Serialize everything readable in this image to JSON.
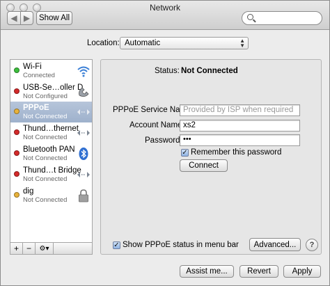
{
  "window": {
    "title": "Network"
  },
  "toolbar": {
    "back": "◀",
    "forward": "▶",
    "show_all": "Show All",
    "search_placeholder": ""
  },
  "location": {
    "label": "Location:",
    "value": "Automatic"
  },
  "services": [
    {
      "name": "Wi-Fi",
      "status": "Connected",
      "dot": "#3cbf3c",
      "icon": "wifi-icon"
    },
    {
      "name": "USB-Se…oller D",
      "status": "Not Configured",
      "dot": "#d42a2a",
      "icon": "phone-icon"
    },
    {
      "name": "PPPoE",
      "status": "Not Connected",
      "dot": "#e8b23a",
      "icon": "ethernet-arrows-icon"
    },
    {
      "name": "Thund…thernet",
      "status": "Not Connected",
      "dot": "#d42a2a",
      "icon": "ethernet-arrows-icon"
    },
    {
      "name": "Bluetooth PAN",
      "status": "Not Connected",
      "dot": "#d42a2a",
      "icon": "bluetooth-icon"
    },
    {
      "name": "Thund…t Bridge",
      "status": "Not Connected",
      "dot": "#d42a2a",
      "icon": "ethernet-arrows-icon"
    },
    {
      "name": "dig",
      "status": "Not Connected",
      "dot": "#e8b23a",
      "icon": "lock-icon"
    }
  ],
  "sidebar_controls": {
    "add": "+",
    "remove": "−",
    "action": "⚙▾"
  },
  "detail": {
    "status_label": "Status:",
    "status_value": "Not Connected",
    "service_name_label": "PPPoE Service Name:",
    "service_name_placeholder": "Provided by ISP when required",
    "account_label": "Account Name:",
    "account_value": "xs2",
    "password_label": "Password:",
    "password_value": "•••",
    "remember_label": "Remember this password",
    "connect": "Connect",
    "show_status_label": "Show PPPoE status in menu bar",
    "advanced": "Advanced...",
    "help": "?"
  },
  "footer": {
    "assist": "Assist me...",
    "revert": "Revert",
    "apply": "Apply"
  },
  "colors": {
    "selection": "#a8b8d0",
    "green": "#3cbf3c",
    "red": "#d42a2a",
    "yellow": "#e8b23a"
  }
}
